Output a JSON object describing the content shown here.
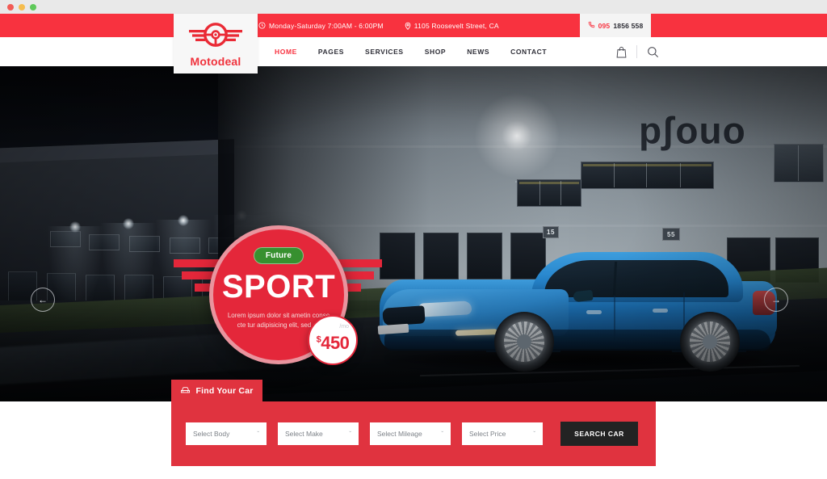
{
  "brand": {
    "name": "Motodeal",
    "logo_icon": "winged-steering-wheel-icon",
    "accent_color": "#f8323f",
    "panel_color": "#e0333f",
    "dark_color": "#232323"
  },
  "browser": {
    "dots": [
      "close-dot",
      "minimize-dot",
      "maximize-dot"
    ]
  },
  "topbar": {
    "hours_icon": "clock-icon",
    "hours": "Monday-Saturday 7:00AM - 6:00PM",
    "address_icon": "location-pin-icon",
    "address": "1105 Roosevelt Street, CA",
    "phone_icon": "phone-icon",
    "phone_code": "095",
    "phone_rest": "1856 558"
  },
  "nav": {
    "items": [
      {
        "label": "HOME",
        "active": true
      },
      {
        "label": "PAGES",
        "active": false
      },
      {
        "label": "SERVICES",
        "active": false
      },
      {
        "label": "SHOP",
        "active": false
      },
      {
        "label": "NEWS",
        "active": false
      },
      {
        "label": "CONTACT",
        "active": false
      }
    ],
    "cart_icon": "shopping-bag-icon",
    "search_icon": "search-icon"
  },
  "hero": {
    "tag": "Future",
    "title": "SPORT",
    "description": "Lorem ipsum dolor sit ametin conse cte tur adipisicing elit, sed do",
    "price_currency": "$",
    "price_value": "450",
    "price_period": "/mo",
    "prev_arrow": "←",
    "next_arrow": "→",
    "building_sign": "onoʃd",
    "building_plate_left": "15",
    "building_plate_right": "55"
  },
  "finder": {
    "tab_icon": "car-front-icon",
    "tab_label": "Find Your Car",
    "fields": [
      {
        "name": "body",
        "value": "Select Body"
      },
      {
        "name": "make",
        "value": "Select Make"
      },
      {
        "name": "mileage",
        "value": "Select Mileage"
      },
      {
        "name": "price",
        "value": "Select Price"
      }
    ],
    "chevron": "ˇ",
    "search_label": "SEARCH CAR"
  }
}
